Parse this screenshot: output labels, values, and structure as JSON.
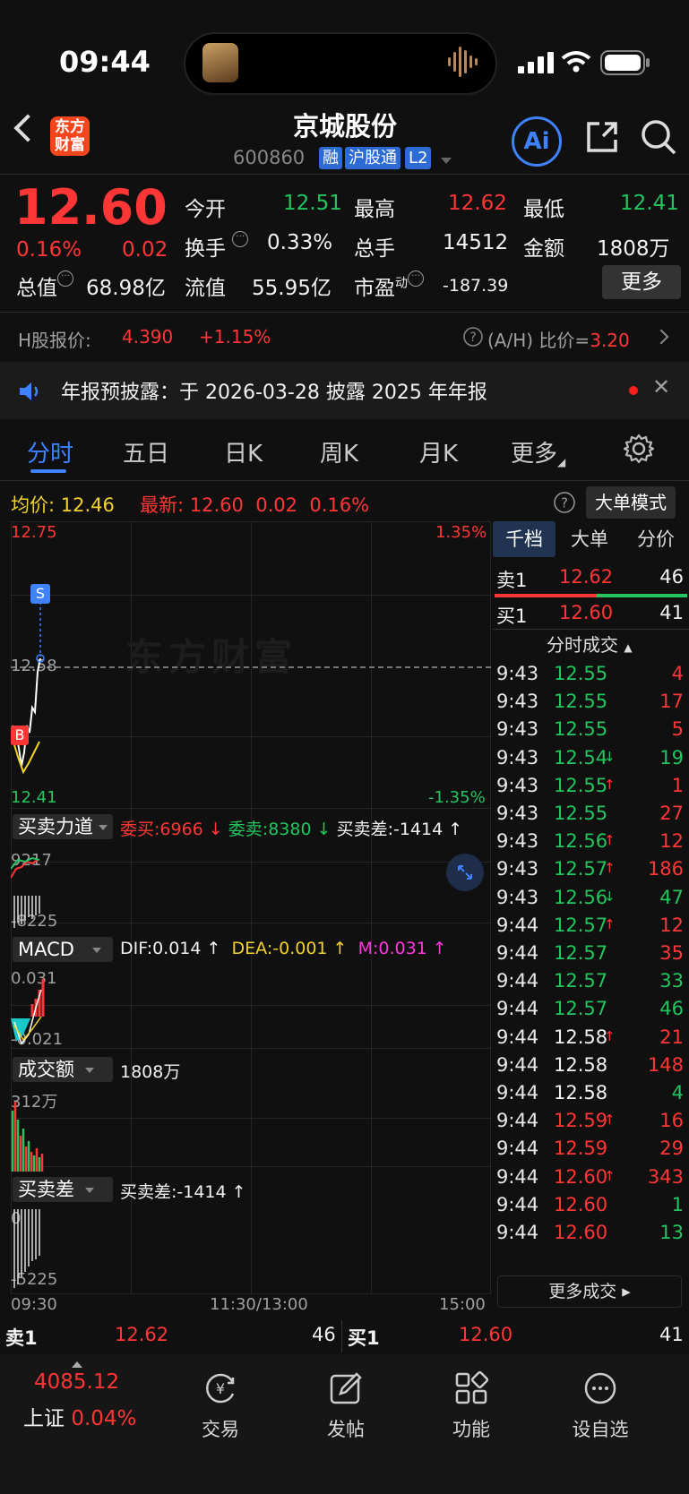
{
  "status": {
    "time": "09:44"
  },
  "header": {
    "logo": [
      "东方",
      "财富"
    ],
    "title": "京城股份",
    "code": "600860",
    "tags": [
      "融",
      "沪股通",
      "L2"
    ],
    "ai_label": "Ai"
  },
  "quote": {
    "price": "12.60",
    "change_pct": "0.16%",
    "change": "0.02",
    "open_label": "今开",
    "open": "12.51",
    "high_label": "最高",
    "high": "12.62",
    "low_label": "最低",
    "low": "12.41",
    "turnover_label": "换手",
    "turnover": "0.33%",
    "volume_label": "总手",
    "volume": "14512",
    "amount_label": "金额",
    "amount": "1808万",
    "mcap_label": "总值",
    "mcap": "68.98亿",
    "float_label": "流值",
    "float": "55.95亿",
    "pe_label": "市盈",
    "pe_sup": "动",
    "pe": "-187.39",
    "more_label": "更多"
  },
  "hshare": {
    "label": "H股报价:",
    "price": "4.390",
    "change": "+1.15%",
    "ah_label": "(A/H) 比价=",
    "ah_value": "3.20"
  },
  "notice": {
    "text": "年报预披露：于 2026-03-28 披露 2025 年年报"
  },
  "tabs": [
    "分时",
    "五日",
    "日K",
    "周K",
    "月K",
    "更多"
  ],
  "summary": {
    "avg_label": "均价:",
    "avg": "12.46",
    "last_label": "最新:",
    "last": "12.60",
    "chg": "0.02",
    "pct": "0.16%",
    "mode_label": "大单模式"
  },
  "chart": {
    "y_top": "12.75",
    "y_top_pct": "1.35%",
    "y_bottom": "12.41",
    "y_bottom_pct": "-1.35%",
    "ref_price": "12.58",
    "watermark": "东方财富",
    "marker_s": "S",
    "marker_b": "B",
    "x_start": "09:30",
    "x_mid": "11:30/13:00",
    "x_end": "15:00"
  },
  "power": {
    "label": "买卖力道",
    "buy_label": "委买:",
    "buy": "6966",
    "sell_label": "委卖:",
    "sell": "8380",
    "diff_label": "买卖差:",
    "diff": "-1414",
    "axis_top": "9217",
    "axis_bottom": "-8225"
  },
  "macd": {
    "label": "MACD",
    "dif": "DIF:0.014",
    "dea": "DEA:-0.001",
    "m": "M:0.031",
    "axis_top": "0.031",
    "axis_bottom": "-0.021"
  },
  "amount_panel": {
    "label": "成交额",
    "value": "1808万",
    "axis_top": "312万"
  },
  "diff_panel": {
    "label": "买卖差",
    "value": "买卖差:-1414",
    "axis_top": "0",
    "axis_bottom": "-5225"
  },
  "right": {
    "tabs": [
      "千档",
      "大单",
      "分价"
    ],
    "ask_label": "卖1",
    "ask_price": "12.62",
    "ask_vol": "46",
    "bid_label": "买1",
    "bid_price": "12.60",
    "bid_vol": "41",
    "ticks_label": "分时成交",
    "more_trades": "更多成交",
    "trades": [
      {
        "time": "9:43",
        "price": "12.55",
        "arrow": "",
        "vol": "4",
        "pc": "green",
        "vc": "red"
      },
      {
        "time": "9:43",
        "price": "12.55",
        "arrow": "",
        "vol": "17",
        "pc": "green",
        "vc": "red"
      },
      {
        "time": "9:43",
        "price": "12.55",
        "arrow": "",
        "vol": "5",
        "pc": "green",
        "vc": "red"
      },
      {
        "time": "9:43",
        "price": "12.54",
        "arrow": "↓",
        "vol": "19",
        "pc": "green",
        "vc": "green"
      },
      {
        "time": "9:43",
        "price": "12.55",
        "arrow": "↑",
        "vol": "1",
        "pc": "green",
        "vc": "red"
      },
      {
        "time": "9:43",
        "price": "12.55",
        "arrow": "",
        "vol": "27",
        "pc": "green",
        "vc": "red"
      },
      {
        "time": "9:43",
        "price": "12.56",
        "arrow": "↑",
        "vol": "12",
        "pc": "green",
        "vc": "red"
      },
      {
        "time": "9:43",
        "price": "12.57",
        "arrow": "↑",
        "vol": "186",
        "pc": "green",
        "vc": "red"
      },
      {
        "time": "9:43",
        "price": "12.56",
        "arrow": "↓",
        "vol": "47",
        "pc": "green",
        "vc": "green"
      },
      {
        "time": "9:44",
        "price": "12.57",
        "arrow": "↑",
        "vol": "12",
        "pc": "green",
        "vc": "red"
      },
      {
        "time": "9:44",
        "price": "12.57",
        "arrow": "",
        "vol": "35",
        "pc": "green",
        "vc": "red"
      },
      {
        "time": "9:44",
        "price": "12.57",
        "arrow": "",
        "vol": "33",
        "pc": "green",
        "vc": "green"
      },
      {
        "time": "9:44",
        "price": "12.57",
        "arrow": "",
        "vol": "46",
        "pc": "green",
        "vc": "green"
      },
      {
        "time": "9:44",
        "price": "12.58",
        "arrow": "↑",
        "vol": "21",
        "pc": "white",
        "vc": "red"
      },
      {
        "time": "9:44",
        "price": "12.58",
        "arrow": "",
        "vol": "148",
        "pc": "white",
        "vc": "red"
      },
      {
        "time": "9:44",
        "price": "12.58",
        "arrow": "",
        "vol": "4",
        "pc": "white",
        "vc": "green"
      },
      {
        "time": "9:44",
        "price": "12.59",
        "arrow": "↑",
        "vol": "16",
        "pc": "red",
        "vc": "red"
      },
      {
        "time": "9:44",
        "price": "12.59",
        "arrow": "",
        "vol": "29",
        "pc": "red",
        "vc": "red"
      },
      {
        "time": "9:44",
        "price": "12.60",
        "arrow": "↑",
        "vol": "343",
        "pc": "red",
        "vc": "red"
      },
      {
        "time": "9:44",
        "price": "12.60",
        "arrow": "",
        "vol": "1",
        "pc": "red",
        "vc": "green"
      },
      {
        "time": "9:44",
        "price": "12.60",
        "arrow": "",
        "vol": "13",
        "pc": "red",
        "vc": "green"
      }
    ]
  },
  "order_row": {
    "ask_label": "卖1",
    "ask_price": "12.62",
    "ask_vol": "46",
    "bid_label": "买1",
    "bid_price": "12.60",
    "bid_vol": "41"
  },
  "bottom_nav": {
    "index_value": "4085.12",
    "index_label": "上证",
    "index_pct": "0.04%",
    "items": [
      "交易",
      "发帖",
      "功能",
      "设自选"
    ]
  },
  "colors": {
    "up": "#ff3636",
    "down": "#22c55e",
    "accent": "#3f82ff",
    "avg_line": "#f3d12a"
  }
}
